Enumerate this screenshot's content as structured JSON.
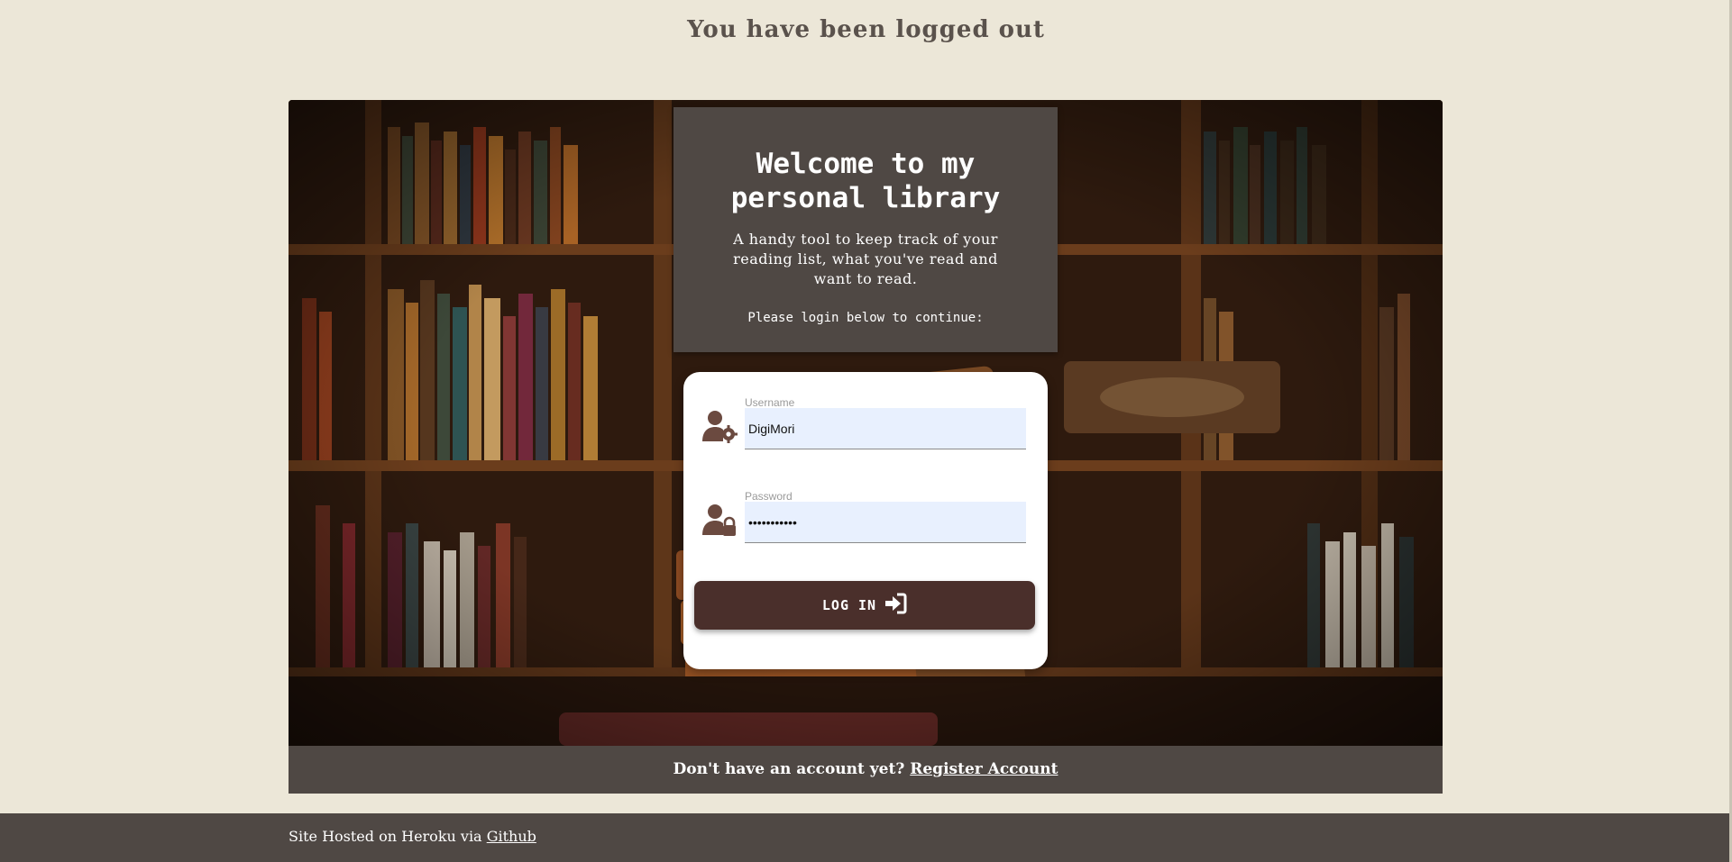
{
  "flash": {
    "message": "You have been logged out"
  },
  "welcome": {
    "title": "Welcome to my personal library",
    "tagline": "A handy tool to keep track of your reading list, what you've read and want to read.",
    "prompt": "Please login below to continue:"
  },
  "login": {
    "username_label": "Username",
    "username_value": "DigiMori",
    "password_label": "Password",
    "password_value": "•••••••••••",
    "button_label": "LOG IN",
    "icon_user": "user-gear-icon",
    "icon_password": "user-lock-icon",
    "icon_button": "sign-in-icon"
  },
  "register": {
    "prompt": "Don't have an account yet?",
    "link": "Register Account"
  },
  "footer": {
    "text": "Site Hosted on Heroku via",
    "link": "Github"
  },
  "colors": {
    "page_bg": "#ece7d8",
    "panel_bg": "#4f4844",
    "button_bg": "#4a2f2b",
    "input_bg": "#e8f0fe",
    "icon": "#6b4a40"
  }
}
